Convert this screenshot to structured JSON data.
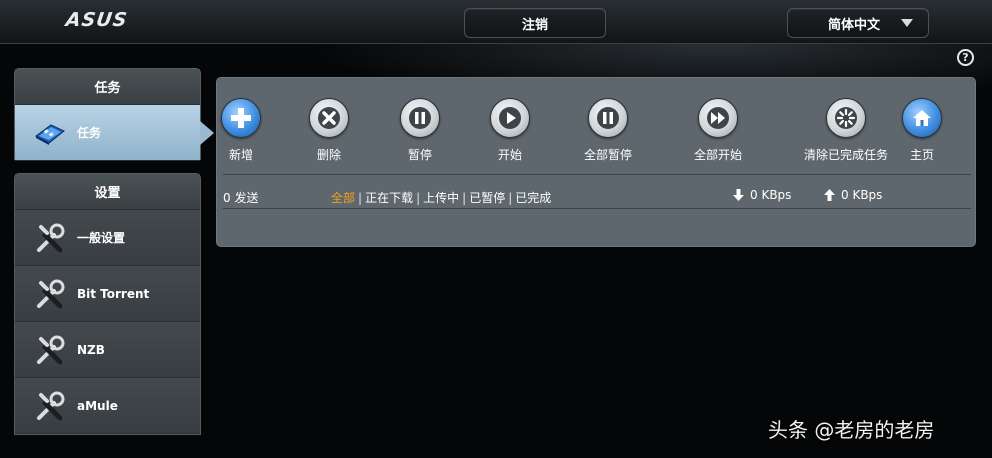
{
  "header": {
    "logo": "ASUS",
    "logout_label": "注销",
    "language_label": "简体中文",
    "help": "?"
  },
  "sidebar": {
    "task_section": {
      "title": "任务",
      "items": [
        {
          "label": "任务",
          "icon": "task-icon",
          "active": true
        }
      ]
    },
    "settings_section": {
      "title": "设置",
      "items": [
        {
          "label": "一般设置",
          "icon": "tools-icon"
        },
        {
          "label": "Bit Torrent",
          "icon": "tools-icon"
        },
        {
          "label": "NZB",
          "icon": "tools-icon"
        },
        {
          "label": "aMule",
          "icon": "tools-icon"
        }
      ]
    }
  },
  "toolbar": {
    "add_label": "新增",
    "delete_label": "删除",
    "pause_label": "暂停",
    "start_label": "开始",
    "pause_all_label": "全部暂停",
    "start_all_label": "全部开始",
    "clear_completed_label": "清除已完成任务",
    "home_label": "主页"
  },
  "status": {
    "sent": "0 发送",
    "filters": [
      "全部",
      "正在下载",
      "上传中",
      "已暂停",
      "已完成"
    ],
    "selected_filter": "全部",
    "filter_separator": "|",
    "download_speed": "0 KBps",
    "upload_speed": "0 KBps"
  },
  "watermark": "头条 @老房的老房",
  "colors": {
    "accent_selected": "#f3a21b",
    "panel": "#5e676d",
    "active_item": "#9abad0"
  }
}
